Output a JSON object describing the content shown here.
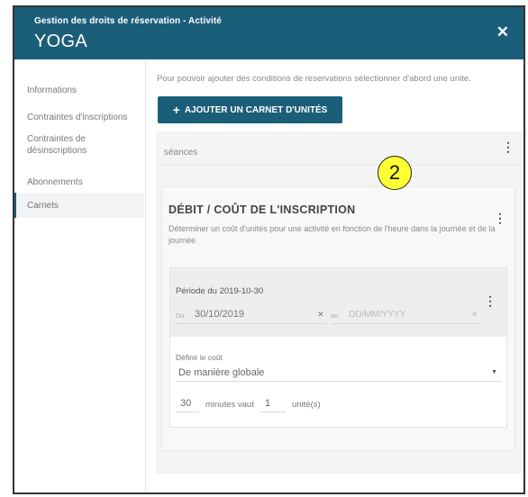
{
  "header": {
    "subtitle": "Gestion des droits de réservation - Activité",
    "title": "YOGA",
    "close_icon": "close-icon"
  },
  "sidebar": {
    "items": [
      {
        "label": "Informations",
        "active": false
      },
      {
        "label": "Contraintes d'inscriptions",
        "active": false
      },
      {
        "label": "Contraintes de désinscriptions",
        "active": false
      },
      {
        "label": "Abonnements",
        "active": false
      },
      {
        "label": "Carnets",
        "active": true
      }
    ]
  },
  "main": {
    "hint": "Pour pouvoir ajouter des conditions de reservations sélectionner d'abord une unite.",
    "add_button_label": "AJOUTER UN CARNET D'UNITÉS",
    "unit_panel": {
      "label": "séances",
      "card": {
        "title": "DÉBIT / COÛT DE L'INSCRIPTION",
        "description": "Déterminer un coût d'unités pour une activité en fonction de l'heure dans la journée et de la journée",
        "period": {
          "title": "Période du 2019-10-30",
          "from_prefix": "Du",
          "from_value": "30/10/2019",
          "to_prefix": "au",
          "to_placeholder": "DD/MM/YYYY",
          "cost_label": "Définir le coût",
          "cost_mode": "De manière globale",
          "minutes": "30",
          "minutes_text": "minutes vaut",
          "units": "1",
          "units_text": "unité(s)"
        }
      }
    }
  },
  "annotation": {
    "label": "2"
  },
  "colors": {
    "header_bg": "#1b5e79",
    "button_bg": "#1b5e79",
    "badge_bg": "#ffff33"
  }
}
